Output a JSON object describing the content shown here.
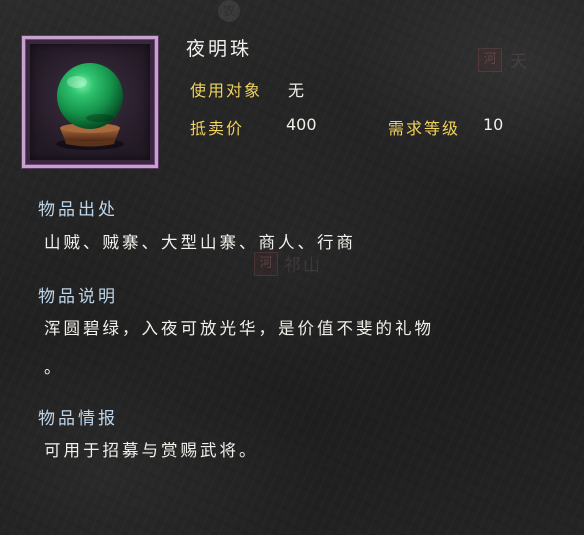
{
  "item": {
    "name": "夜明珠",
    "icon": "green-pearl-on-stand-icon",
    "frame_color": "#c7a2cf"
  },
  "stats": {
    "target_label": "使用对象",
    "target_value": "无",
    "price_label": "抵卖价",
    "price_value": "400",
    "level_label": "需求等级",
    "level_value": "10"
  },
  "sections": {
    "source": {
      "heading": "物品出处",
      "text": "山贼、贼寨、大型山寨、商人、行商"
    },
    "description": {
      "heading": "物品说明",
      "line1": "浑圆碧绿，入夜可放光华，是价值不斐的礼物",
      "line2": "。"
    },
    "intel": {
      "heading": "物品情报",
      "text": "可用于招募与赏赐武将。"
    }
  },
  "background": {
    "circle_glyph": "农",
    "seal_glyph_right": "河",
    "label_right": "天",
    "seal_glyph_center": "河",
    "label_center": "祁山"
  },
  "colors": {
    "label_yellow": "#f1d25c",
    "heading_blue": "#bfd6ea",
    "pearl_green": "#1aa55a"
  }
}
